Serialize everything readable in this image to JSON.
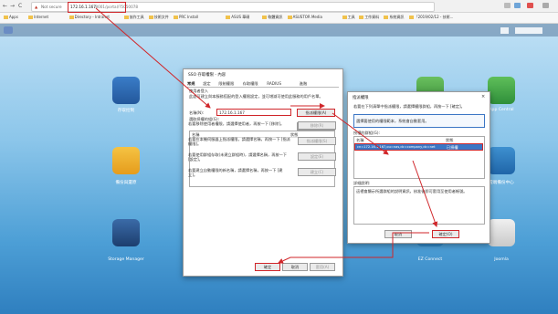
{
  "browser": {
    "nav": {
      "back": "←",
      "forward": "→",
      "reload": "C"
    },
    "security": "Not secure",
    "url_ip": "172.16.1.167",
    "url_rest": ":8001/portal/?5050078",
    "bookmarks": [
      "Apps",
      "Internet",
      "Directory - Intranet",
      "協作工具",
      "技術文件",
      "PRC Install",
      "ASUS 華碩",
      "軟體資訊",
      "ASUSTOR Media",
      "工具",
      "工作資料",
      "系統資訊",
      "「2019/02/12 - 技術..."
    ]
  },
  "desktop": {
    "apps": [
      {
        "label": "存取控制"
      },
      {
        "label": "備份與還原"
      },
      {
        "label": "Storage Manager"
      },
      {
        "label": "App Central"
      },
      {
        "label": "EZ Connect"
      },
      {
        "label": "雲端備份中心"
      },
      {
        "label": "Joomla"
      }
    ]
  },
  "main_dialog": {
    "title": "SSO 存取權限 - 內容",
    "tabs": [
      "常規",
      "設定",
      "限制權限",
      "存取權限",
      "RADIUS",
      "進階"
    ],
    "desc_label": "使用者登入",
    "desc": "此處可建立與本服務搭配的登入權限設定，並可增減可使用此服務的用戶名單。",
    "name_label": "名稱(N):",
    "name_value": "172.16.1.167",
    "select_button": "指派權限(A)",
    "list_label": "選取授權的組(G):",
    "add_button": "新增群組(D)",
    "col_name": "名稱",
    "col_status": "狀態",
    "rules": [
      {
        "text": "若要移除使用者權限，請選擇使用者，再按一下 [移除]。",
        "button": "移除(R)"
      },
      {
        "text": "若要在本機伺服器上指派權限，請選擇名稱，再按一下 [指派權限]。",
        "button": "指派權限(S)"
      },
      {
        "text": "若要使用群組存取(未建立群組時)，請選擇名稱，再按一下 [設定]。",
        "button": "設定(E)"
      },
      {
        "text": "若要建立自動權限的新名稱，請選擇名稱，再按一下 [建立]。",
        "button": "建立(C)"
      }
    ],
    "ok": "確定",
    "cancel": "取消",
    "apply": "套用(A)"
  },
  "sub_dialog": {
    "title": "指派權限",
    "desc": "若要在下列清單中指派權限，請選擇權限群組，再按一下 [確定]。",
    "info": "選擇要使用的權限範本，系統會自動套用。",
    "list_label": "授權的群組(G):",
    "col_name": "名稱",
    "col_status": "狀態",
    "row_name": "cn=172.16.1.167,ou=nas,dc=company,dc=net",
    "row_status": "已授權",
    "detail_label": "詳細說明:",
    "detail": "這裡會顯示所選群組的說明資訊，核准後即可套用至使用者帳號。",
    "ok": "確定(O)",
    "cancel": "取消"
  },
  "colors": {
    "accent_red": "#d0262a",
    "select_blue": "#3b76c4"
  }
}
